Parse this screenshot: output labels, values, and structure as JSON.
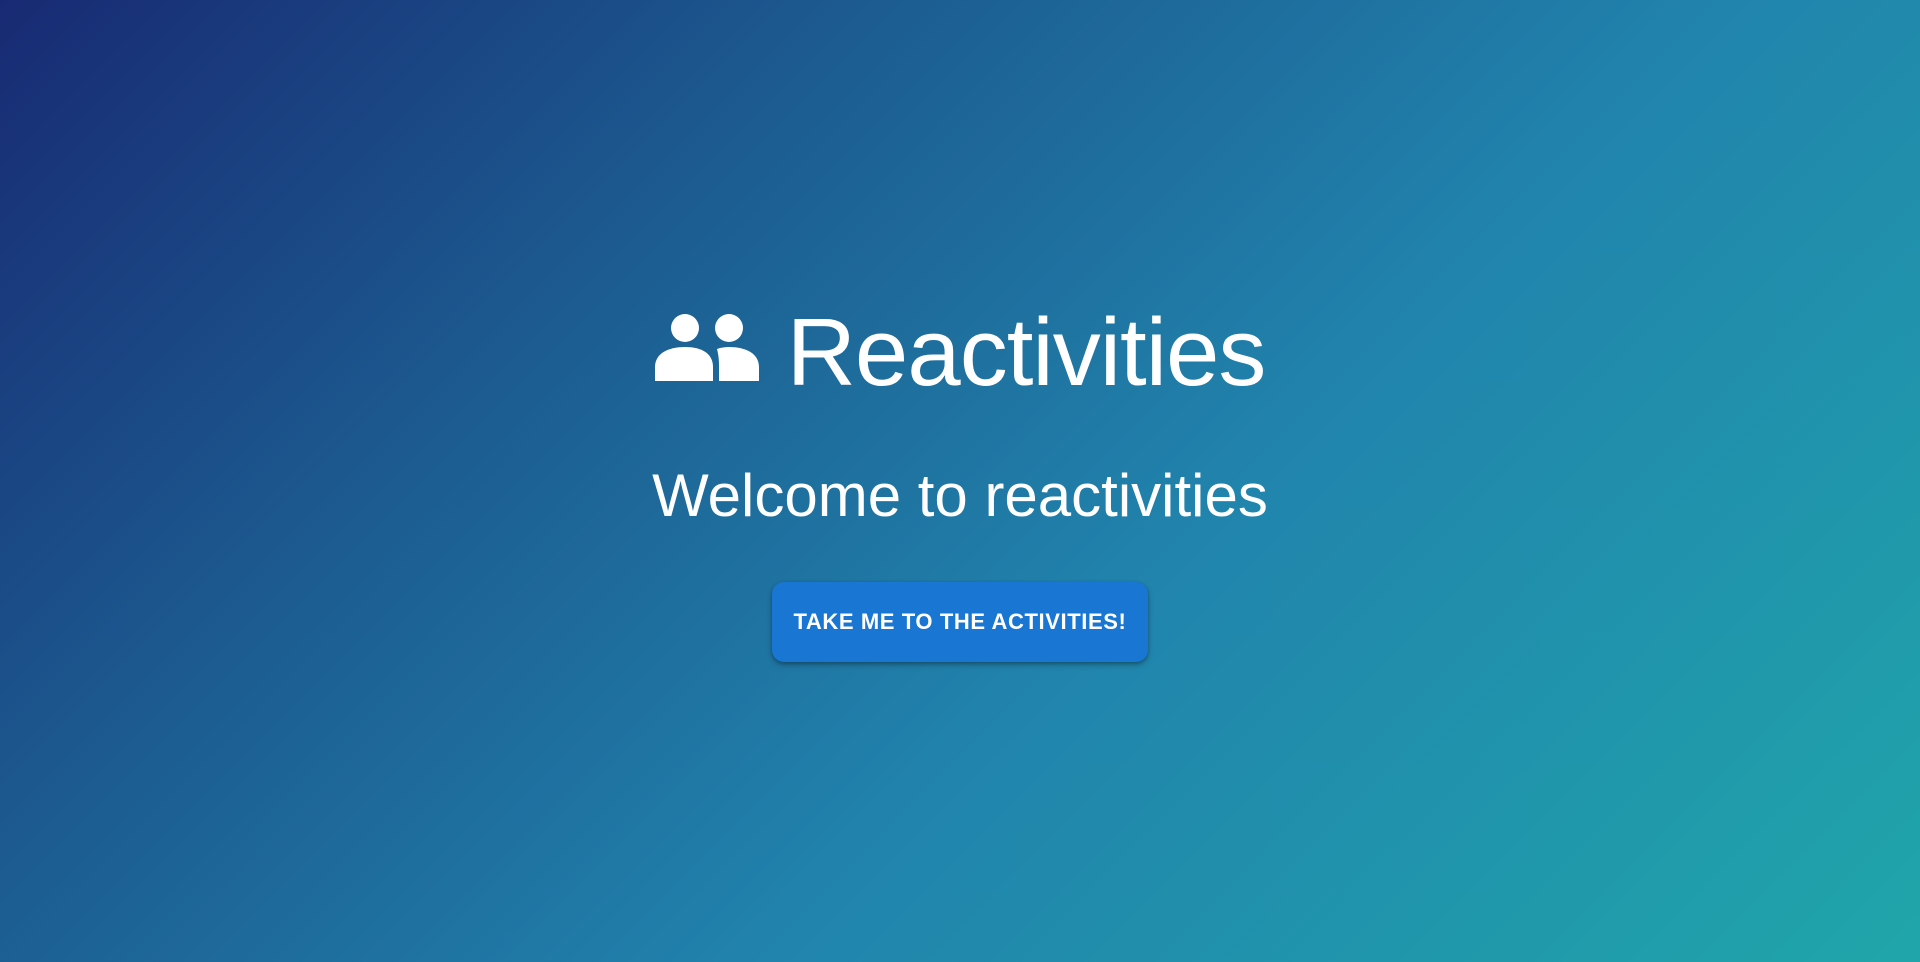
{
  "app": {
    "title": "Reactivities",
    "icon": "group-icon"
  },
  "hero": {
    "welcome_text": "Welcome to reactivities",
    "cta_label": "TAKE ME TO THE ACTIVITIES!"
  },
  "theme": {
    "gradient_start": "#182a73",
    "gradient_end": "#20a6aa",
    "button_color": "#1976d2",
    "text_color": "#ffffff"
  }
}
